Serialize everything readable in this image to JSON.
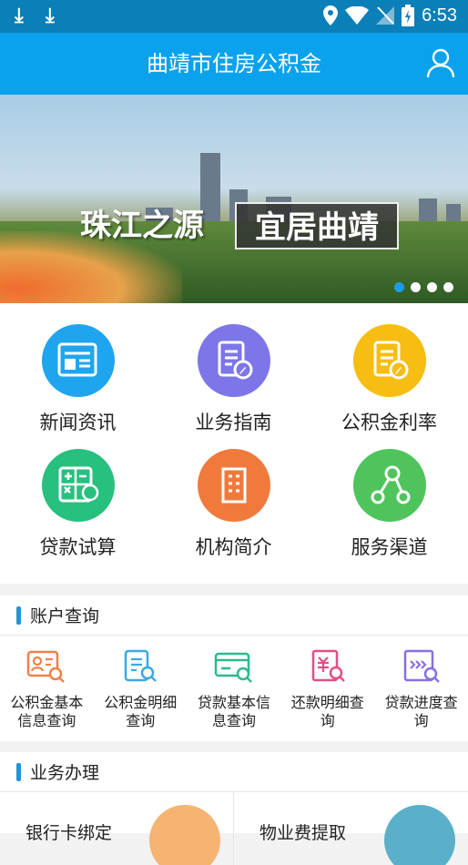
{
  "status_bar": {
    "time": "6:53",
    "icons": [
      "download-icon",
      "download-icon",
      "location-icon",
      "wifi-icon",
      "no-sim-icon",
      "battery-charging-icon"
    ]
  },
  "app_bar": {
    "title": "曲靖市住房公积金",
    "user_icon": "user-icon"
  },
  "banner": {
    "caption_left": "珠江之源",
    "caption_right": "宜居曲靖",
    "slide_count": 4,
    "active_slide": 1
  },
  "services": [
    {
      "label": "新闻资讯",
      "icon": "news-icon",
      "color": "#1fa5ee"
    },
    {
      "label": "业务指南",
      "icon": "guide-icon",
      "color": "#7c76e8"
    },
    {
      "label": "公积金利率",
      "icon": "rate-icon",
      "color": "#f6bd12"
    },
    {
      "label": "贷款试算",
      "icon": "calculator-icon",
      "color": "#27c07f"
    },
    {
      "label": "机构简介",
      "icon": "building-icon",
      "color": "#f07a3c"
    },
    {
      "label": "服务渠道",
      "icon": "channels-icon",
      "color": "#4fc45d"
    }
  ],
  "account_query": {
    "title": "账户查询",
    "items": [
      {
        "line1": "公积金基本",
        "line2": "信息查询",
        "icon": "profile-search-icon",
        "color": "#f0804a"
      },
      {
        "line1": "公积金明细",
        "line2": "查询",
        "icon": "detail-search-icon",
        "color": "#3aa9e0"
      },
      {
        "line1": "贷款基本信",
        "line2": "息查询",
        "icon": "card-search-icon",
        "color": "#2dbb8a"
      },
      {
        "line1": "还款明细查",
        "line2": "询",
        "icon": "repay-search-icon",
        "color": "#e04f86"
      },
      {
        "line1": "贷款进度查",
        "line2": "询",
        "icon": "progress-search-icon",
        "color": "#8a6fe0"
      }
    ]
  },
  "business": {
    "title": "业务办理",
    "items": [
      {
        "label": "银行卡绑定",
        "icon": "bank-card-icon",
        "color": "#f6b472"
      },
      {
        "label": "物业费提取",
        "icon": "tools-icon",
        "color": "#5bb0c9"
      }
    ]
  }
}
